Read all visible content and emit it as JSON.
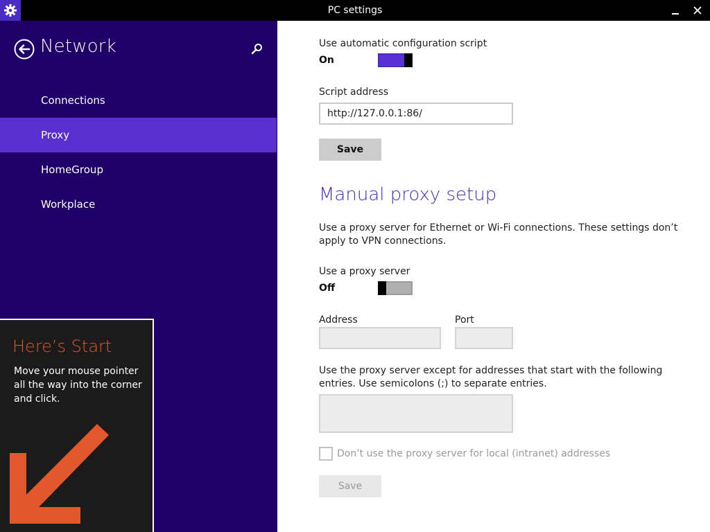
{
  "window": {
    "title": "PC settings",
    "app_icon": "gear-icon",
    "minimize_icon": "minimize-icon",
    "close_icon": "close-icon"
  },
  "nav": {
    "title": "Network",
    "back_icon": "back-arrow-icon",
    "search_icon": "search-icon",
    "items": [
      {
        "label": "Connections",
        "selected": false
      },
      {
        "label": "Proxy",
        "selected": true
      },
      {
        "label": "HomeGroup",
        "selected": false
      },
      {
        "label": "Workplace",
        "selected": false
      }
    ]
  },
  "tip": {
    "title": "Here’s Start",
    "body": "Move your mouse pointer all the way into the corner and click."
  },
  "auto_config": {
    "label": "Use automatic configuration script",
    "state": "On",
    "script_address_label": "Script address",
    "script_address_value": "http://127.0.0.1:86/",
    "save_label": "Save"
  },
  "manual": {
    "heading": "Manual proxy setup",
    "description": "Use a proxy server for Ethernet or Wi-Fi connections. These settings don’t apply to VPN connections.",
    "use_proxy_label": "Use a proxy server",
    "state": "Off",
    "address_label": "Address",
    "address_value": "",
    "port_label": "Port",
    "port_value": "",
    "exceptions_text": "Use the proxy server except for addresses that start with the following entries. Use semicolons (;) to separate entries.",
    "exceptions_value": "",
    "local_checkbox_label": "Don’t use the proxy server for local (intranet) addresses",
    "local_checkbox_checked": false,
    "save_label": "Save"
  },
  "colors": {
    "nav_bg": "#1f0068",
    "selected_bg": "#5a2fd0",
    "accent": "#4a2cc4",
    "tip_title": "#e2582c"
  }
}
